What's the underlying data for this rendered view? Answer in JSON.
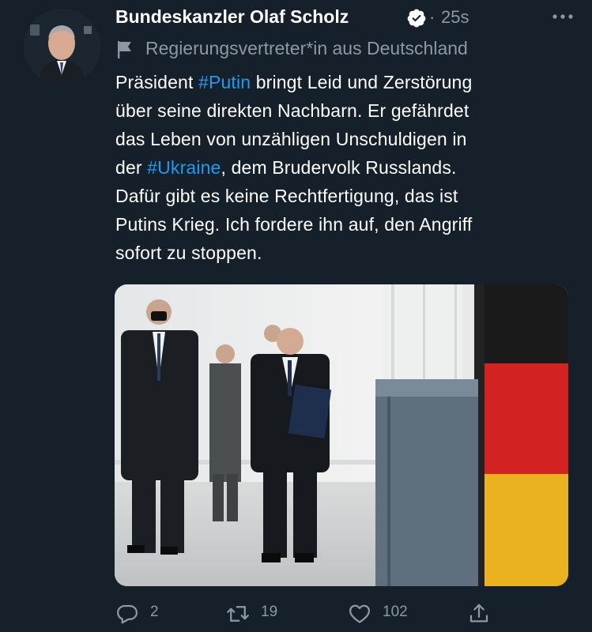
{
  "tweet": {
    "author": {
      "name": "Bundeskanzler Olaf Scholz",
      "verified": true,
      "avatar_icon": "profile-photo"
    },
    "separator": "·",
    "time": "25s",
    "label": "Regierungsvertreter*in aus Deutschland",
    "text_lines": [
      [
        {
          "t": "Präsident "
        },
        {
          "t": "#Putin",
          "tag": true
        },
        {
          "t": " bringt Leid und Zerstörung"
        }
      ],
      [
        {
          "t": "über seine direkten Nachbarn. Er gefährdet"
        }
      ],
      [
        {
          "t": "das Leben von unzähligen Unschuldigen in"
        }
      ],
      [
        {
          "t": "der "
        },
        {
          "t": "#Ukraine",
          "tag": true
        },
        {
          "t": ", dem Brudervolk Russlands."
        }
      ],
      [
        {
          "t": "Dafür gibt es keine Rechtfertigung, das ist"
        }
      ],
      [
        {
          "t": "Putins Krieg. Ich fordere ihn auf, den Angriff"
        }
      ],
      [
        {
          "t": "sofort zu stoppen."
        }
      ]
    ],
    "stats": {
      "replies": "2",
      "retweets": "19",
      "likes": "102"
    }
  },
  "colors": {
    "background": "#15202b",
    "text": "#ffffff",
    "secondary": "#8b98a5",
    "link": "#1d9bf0"
  }
}
